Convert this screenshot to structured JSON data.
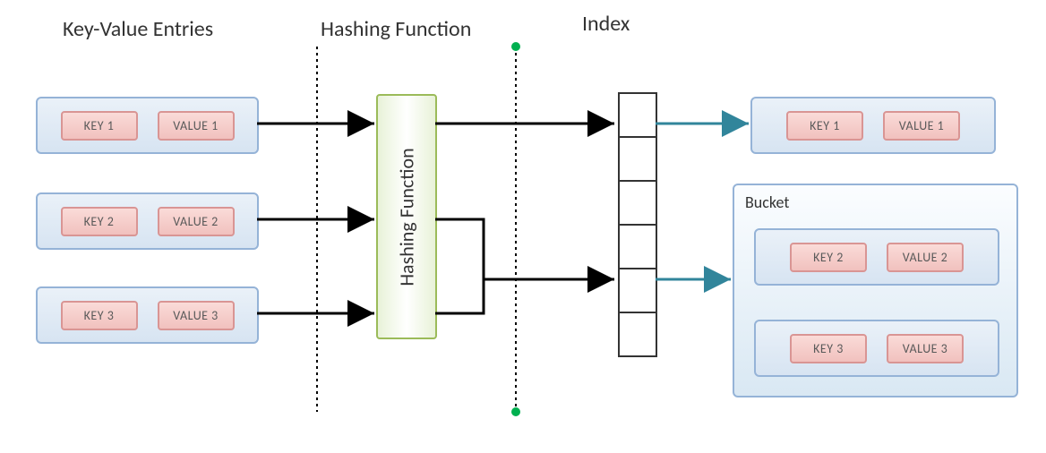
{
  "headings": {
    "entries": "Key-Value Entries",
    "hashing": "Hashing Function",
    "index": "Index"
  },
  "hash_box_label": "Hashing Function",
  "entries": [
    {
      "key": "KEY 1",
      "value": "VALUE 1"
    },
    {
      "key": "KEY 2",
      "value": "VALUE 2"
    },
    {
      "key": "KEY 3",
      "value": "VALUE 3"
    }
  ],
  "output_single": {
    "key": "KEY 1",
    "value": "VALUE 1"
  },
  "bucket": {
    "label": "Bucket",
    "items": [
      {
        "key": "KEY 2",
        "value": "VALUE 2"
      },
      {
        "key": "KEY 3",
        "value": "VALUE 3"
      }
    ]
  },
  "index_slots": 6,
  "colors": {
    "blue_border": "#95b3d7",
    "pink_border": "#d99594",
    "green_border": "#9bbb59",
    "teal_arrow": "#31859b",
    "black": "#000000",
    "green_dot": "#00b050"
  }
}
